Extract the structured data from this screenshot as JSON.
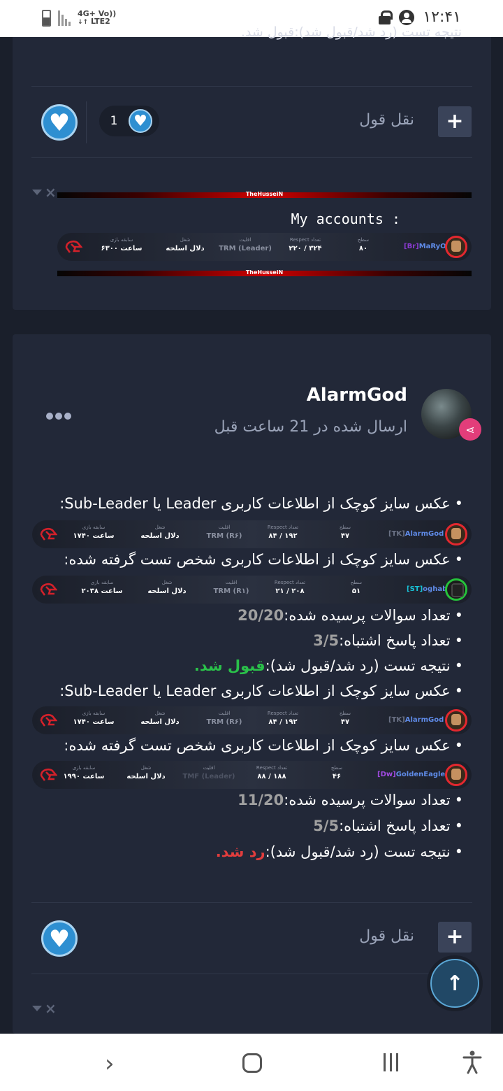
{
  "status_bar": {
    "network": "4G+",
    "network2": "LTE2",
    "volte": "Vo))",
    "time": "۱۲:۴۱"
  },
  "post1": {
    "cut_text": "نتیجه تست (رد شد/قبول شد):قبول شد.",
    "reaction_count": "1",
    "quote_label": "نقل قول",
    "plus_label": "+",
    "banner_text": "TheHusseiN",
    "signature_title": "My accounts :",
    "userbar": {
      "tag": "[Br]",
      "name": "MaRyO",
      "level_h": "سطح",
      "level": "۸۰",
      "respect_h": "Respect تعداد",
      "respect": "۲۲۰ / ۳۲۴",
      "minority_h": "اقلیت",
      "minority": "TRM (Leader)",
      "job_h": "شغل",
      "job": "دلال اسلحه",
      "history_h": "سابقه بازی",
      "history": "۶۳۰۰ ساعت"
    }
  },
  "post2": {
    "author": "AlarmGod",
    "posted": "ارسال شده در 21 ساعت قبل",
    "lines": {
      "l1": "عکس سایز کوچک از اطلاعات کاربری Leader یا Sub-Leader:",
      "l2": "عکس سایز کوچک از اطلاعات کاربری شخص تست گرفته شده:",
      "l3_label": "تعداد سوالات پرسیده شده:",
      "l3_val": "20/20",
      "l4_label": "تعداد پاسخ اشتباه:",
      "l4_val": "3/5",
      "l5_label": "نتیجه تست (رد شد/قبول شد):",
      "l5_val": "قبول شد.",
      "l6": "عکس سایز کوچک از اطلاعات کاربری Leader یا Sub-Leader:",
      "l7": "عکس سایز کوچک از اطلاعات کاربری شخص تست گرفته شده:",
      "l8_label": "تعداد سوالات پرسیده شده:",
      "l8_val": "11/20",
      "l9_label": "تعداد پاسخ اشتباه:",
      "l9_val": "5/5",
      "l10_label": "نتیجه تست (رد شد/قبول شد):",
      "l10_val": "رد شد."
    },
    "bar_alarm": {
      "tag": "[TK]",
      "name": "AlarmGod",
      "level": "۴۷",
      "respect": "۸۴ / ۱۹۲",
      "minority": "TRM (R۶)",
      "job": "دلال اسلحه",
      "history": "۱۷۴۰ ساعت"
    },
    "bar_oghab": {
      "tag": "[ST]",
      "name": "oghab.",
      "level": "۵۱",
      "respect": "۲۱ / ۲۰۸",
      "minority": "TRM (R۱)",
      "job": "دلال اسلحه",
      "history": "۲۰۳۸ ساعت"
    },
    "bar_golden": {
      "tag": "[Dw]",
      "name": "GoldenEagle",
      "level": "۴۶",
      "respect": "۸۸ / ۱۸۸",
      "minority": "TMF (Leader)",
      "job": "دلال اسلحه",
      "history": "۱۹۹۰ ساعت"
    },
    "headers": {
      "level": "سطح",
      "respect": "Respect تعداد",
      "minority": "اقلیت",
      "job": "شغل",
      "history": "سابقه بازی"
    },
    "quote_label": "نقل قول",
    "plus_label": "+"
  },
  "scroll_top_label": "↑",
  "colors": {
    "background": "#1a1f2b",
    "card": "#222838",
    "accent_blue": "#2e8fd1",
    "accepted_green": "#2ac14a",
    "rejected_red": "#e23d3d"
  }
}
